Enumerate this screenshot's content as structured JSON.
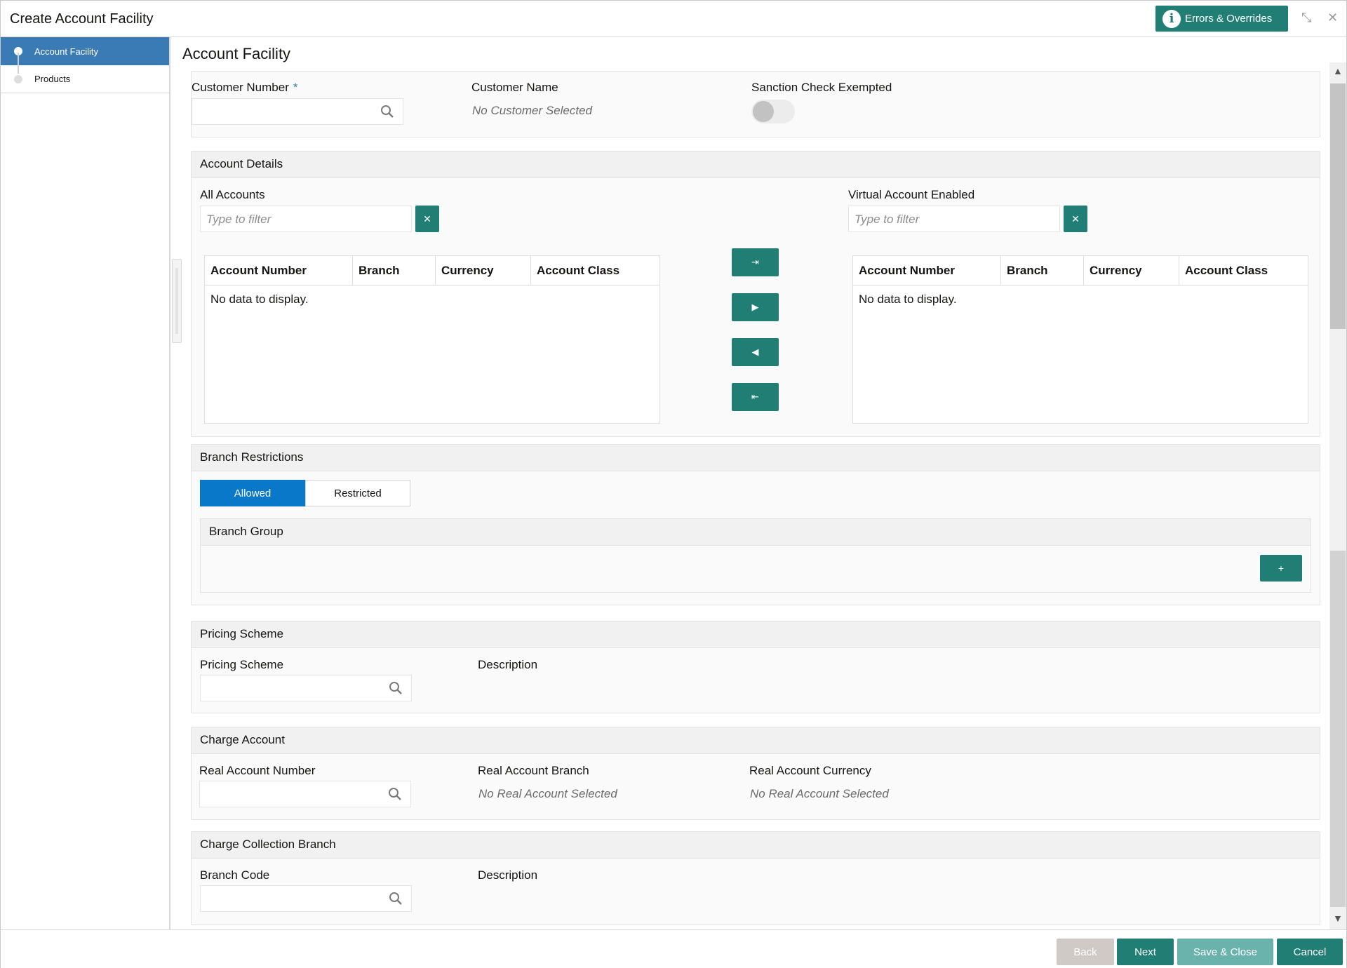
{
  "window": {
    "title": "Create Account Facility",
    "errors_label": "Errors & Overrides"
  },
  "sidebar": {
    "items": [
      {
        "label": "Account Facility",
        "active": true
      },
      {
        "label": "Products",
        "active": false
      }
    ]
  },
  "page_title": "Account Facility",
  "customer": {
    "number_label": "Customer Number",
    "number_required_mark": "*",
    "number_value": "",
    "name_label": "Customer Name",
    "name_value": "No Customer Selected",
    "sanction_label": "Sanction Check Exempted",
    "sanction_on": false
  },
  "account_details": {
    "header": "Account Details",
    "all_accounts_label": "All Accounts",
    "all_filter_placeholder": "Type to filter",
    "virtual_label": "Virtual Account Enabled",
    "virtual_filter_placeholder": "Type to filter",
    "columns": [
      "Account Number",
      "Branch",
      "Currency",
      "Account Class"
    ],
    "left_empty": "No data to display.",
    "right_empty": "No data to display.",
    "shuttle_icons": [
      "move-all-right-icon",
      "move-right-icon",
      "move-left-icon",
      "move-all-left-icon"
    ]
  },
  "branch_restrictions": {
    "header": "Branch Restrictions",
    "options": [
      "Allowed",
      "Restricted"
    ],
    "selected": "Allowed",
    "group_header": "Branch Group",
    "add_label": "+"
  },
  "pricing": {
    "header": "Pricing Scheme",
    "scheme_label": "Pricing Scheme",
    "description_label": "Description"
  },
  "charge_account": {
    "header": "Charge Account",
    "number_label": "Real Account Number",
    "branch_label": "Real Account Branch",
    "branch_value": "No Real Account Selected",
    "currency_label": "Real Account Currency",
    "currency_value": "No Real Account Selected"
  },
  "charge_branch": {
    "header": "Charge Collection Branch",
    "code_label": "Branch Code",
    "description_label": "Description"
  },
  "footer": {
    "back": "Back",
    "next": "Next",
    "save_close": "Save & Close",
    "cancel": "Cancel"
  },
  "colors": {
    "primary": "#207e75",
    "nav_active": "#3a7ab5",
    "segment_on": "#0a78c8"
  }
}
